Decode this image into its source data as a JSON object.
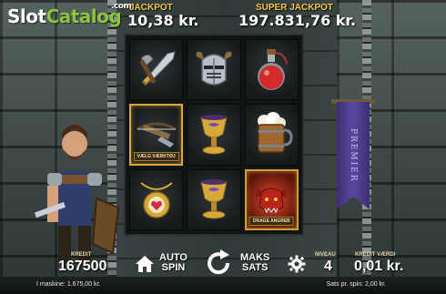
{
  "brand": {
    "part1": "Slot",
    "part2": "Catalog",
    "suffix": ".com"
  },
  "jackpot": {
    "label": "JACKPOT",
    "value": "10,38 kr."
  },
  "super_jackpot": {
    "label": "SUPER JACKPOT",
    "value": "197.831,76 kr."
  },
  "reels": [
    {
      "symbol": "weapons"
    },
    {
      "symbol": "knight-helmet"
    },
    {
      "symbol": "red-potion"
    },
    {
      "symbol": "crossbow",
      "label": "VÆLG VÆRKTØJ"
    },
    {
      "symbol": "golden-goblet"
    },
    {
      "symbol": "beer-mug"
    },
    {
      "symbol": "amulet"
    },
    {
      "symbol": "golden-goblet"
    },
    {
      "symbol": "dragon",
      "label": "DRAGE ANGREB"
    }
  ],
  "banner": {
    "text": "PREMIER"
  },
  "controls": {
    "kredit_label": "KREDIT",
    "kredit_value": "167500",
    "home_icon": "home-icon",
    "autospin_line1": "AUTO",
    "autospin_line2": "SPIN",
    "spin_icon": "spin-icon",
    "maks_line1": "MAKS",
    "maks_line2": "SATS",
    "settings_icon": "gear-icon",
    "niveau_label": "NIVEAU",
    "niveau_value": "4",
    "kreditvaerdi_label": "KREDIT VÆRDI",
    "kreditvaerdi_value": "0,01 kr."
  },
  "status": {
    "machine_label": "I maskine: 1.675,00 kr.",
    "bet_label": "Sats pr. spin: 2,00 kr."
  },
  "colors": {
    "gold": "#f5c842",
    "banner": "#4a3a8c",
    "brand_green": "#8bc43f"
  }
}
